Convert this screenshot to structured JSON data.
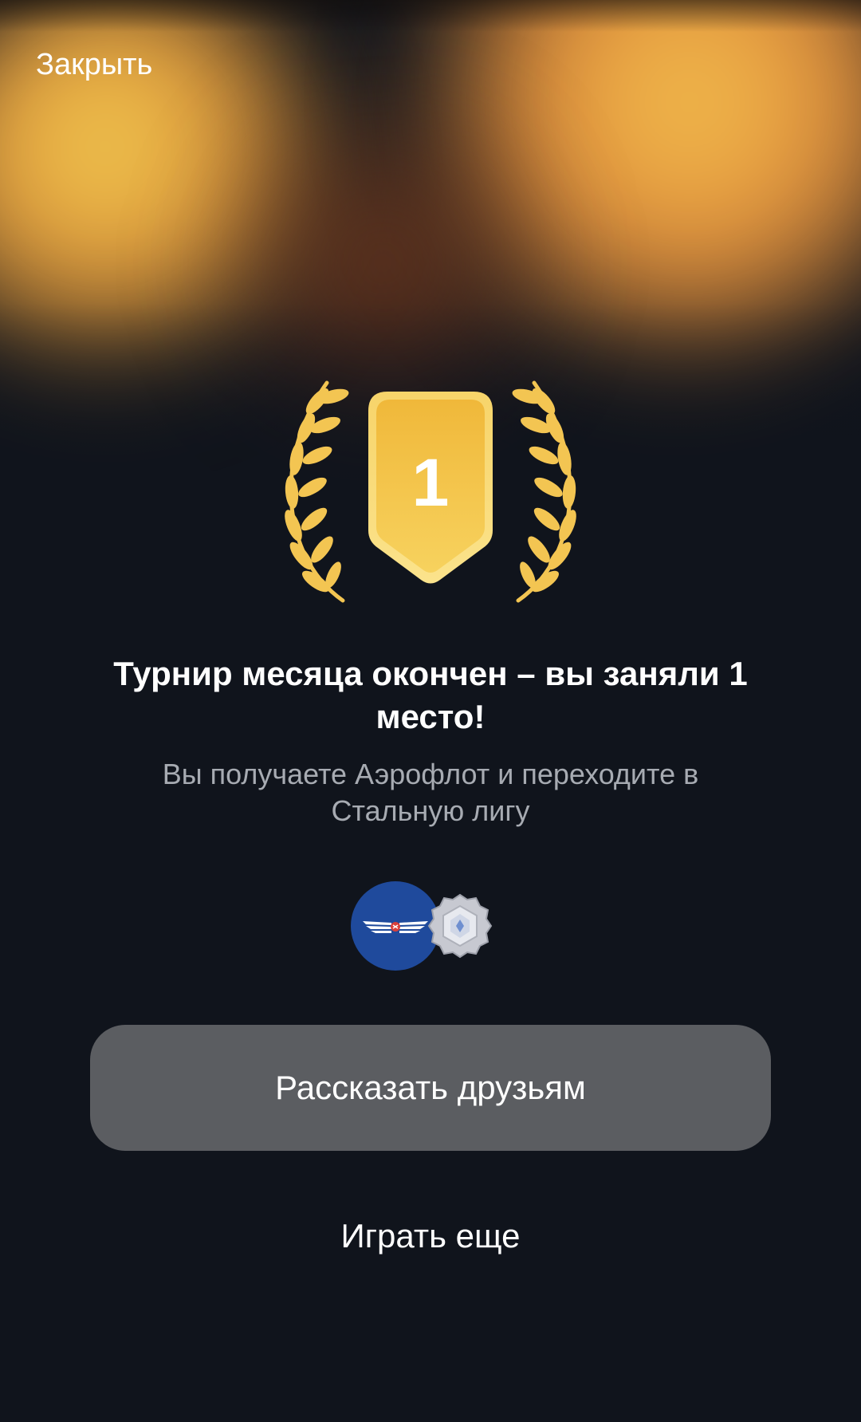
{
  "header": {
    "close_label": "Закрыть"
  },
  "badge": {
    "place": "1",
    "color": "#f2bf3f",
    "laurel_color": "#f3c552"
  },
  "result": {
    "headline": "Турнир месяца окончен – вы заняли 1 место!",
    "subtext": "Вы получаете Аэрофлот и переходите в Стальную лигу"
  },
  "rewards": {
    "items": [
      {
        "icon": "aeroflot-logo-icon",
        "color": "#1f4a9c"
      },
      {
        "icon": "steel-league-icon",
        "color": "#c9cbd3"
      }
    ]
  },
  "actions": {
    "share_label": "Рассказать друзьям",
    "play_again_label": "Играть еще"
  }
}
